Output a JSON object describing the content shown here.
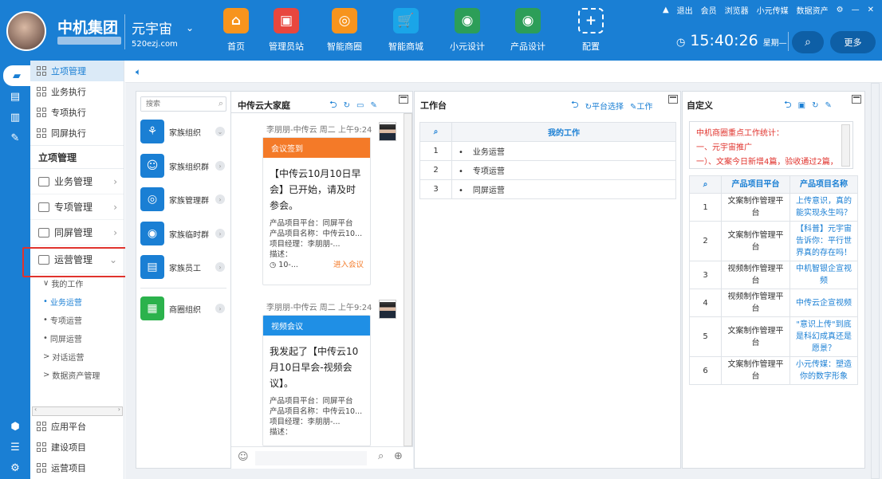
{
  "header": {
    "brand": "中机集团",
    "metaverse": "元宇宙",
    "domain": "520ezj.com",
    "nav": [
      {
        "label": "首页",
        "icon": "home-icon",
        "color": "#f7941d",
        "glyph": "⌂"
      },
      {
        "label": "管理员站",
        "icon": "monitor-icon",
        "color": "#e8473e",
        "glyph": "▣"
      },
      {
        "label": "智能商圈",
        "icon": "ring-icon",
        "color": "#f7941d",
        "glyph": "◎"
      },
      {
        "label": "智能商城",
        "icon": "cart-icon",
        "color": "#1aa5e8",
        "glyph": "🛒"
      },
      {
        "label": "小元设计",
        "icon": "globe-icon",
        "color": "#2c9e58",
        "glyph": "◉"
      },
      {
        "label": "产品设计",
        "icon": "team-icon",
        "color": "#2c9e58",
        "glyph": "◉"
      },
      {
        "label": "配置",
        "icon": "plus-icon",
        "color": "#1a7fd4",
        "glyph": "+"
      }
    ],
    "links": [
      "退出",
      "会员",
      "浏览器",
      "小元传媒",
      "数据资产"
    ],
    "time": "15:40:26",
    "weekday": "星期—",
    "more": "更多"
  },
  "sidebar": {
    "top_items": [
      "立项管理",
      "业务执行",
      "专项执行",
      "同屏执行"
    ],
    "section": "立项管理",
    "groups": [
      "业务管理",
      "专项管理",
      "同屏管理",
      "运营管理"
    ],
    "subs": [
      {
        "label": "我的工作",
        "prefix": "∨"
      },
      {
        "label": "业务运营",
        "prefix": "•"
      },
      {
        "label": "专项运营",
        "prefix": "•"
      },
      {
        "label": "同屏运营",
        "prefix": "•"
      },
      {
        "label": "对话运营",
        "prefix": ">"
      },
      {
        "label": "数据资产管理",
        "prefix": ">"
      }
    ],
    "bottom_items": [
      "应用平台",
      "建设项目",
      "运营项目"
    ]
  },
  "contacts": {
    "search_placeholder": "搜索",
    "categories": [
      {
        "label": "家族组织",
        "color": "#1a7fd4",
        "glyph": "⚘"
      },
      {
        "label": "家族组织群",
        "color": "#1a7fd4",
        "glyph": "☺"
      },
      {
        "label": "家族管理群",
        "color": "#1a7fd4",
        "glyph": "◎"
      },
      {
        "label": "家族临时群",
        "color": "#1a7fd4",
        "glyph": "◉"
      },
      {
        "label": "家族员工",
        "color": "#1a7fd4",
        "glyph": "▤"
      },
      {
        "label": "商圈组织",
        "color": "#2bb24c",
        "glyph": "▦"
      }
    ]
  },
  "chat": {
    "title": "中传云大家庭",
    "messages": [
      {
        "sender": "李朋朋-中传云  周二 上午9:24",
        "header": "会议签到",
        "header_color": "#f47a28",
        "body": "【中传云10月10日早会】已开始，请及时参会。",
        "info": [
          "产品项目平台：同屏平台",
          "产品项目名称：中传云10...",
          "项目经理：李朋朋-...",
          "描述：",
          "◷ 10-..."
        ],
        "action": "进入会议"
      },
      {
        "sender": "李朋朋-中传云  周二 上午9:24",
        "header": "视频会议",
        "header_color": "#1f8fe5",
        "body": "我发起了【中传云10月10日早会-视频会议】。",
        "info": [
          "产品项目平台：同屏平台",
          "产品项目名称：中传云10...",
          "项目经理：李朋朋-...",
          "描述："
        ]
      }
    ]
  },
  "workbench": {
    "title": "工作台",
    "action_platform": "平台选择",
    "action_work": "工作",
    "column": "我的工作",
    "rows": [
      {
        "no": "1",
        "name": "业务运营"
      },
      {
        "no": "2",
        "name": "专项运营"
      },
      {
        "no": "3",
        "name": "同屏运营"
      }
    ]
  },
  "custom": {
    "title": "自定义",
    "notice": [
      "中机商圈重点工作统计：",
      "一、元宇宙推广",
      "一）、文案今日新增4篇，验收通过2篇，"
    ],
    "columns": [
      "产品项目平台",
      "产品项目名称"
    ],
    "rows": [
      {
        "no": "1",
        "platform": "文案制作管理平台",
        "name": "上传意识，真的能实现永生吗？"
      },
      {
        "no": "2",
        "platform": "文案制作管理平台",
        "name": "【科普】元宇宙告诉你：平行世界真的存在吗！"
      },
      {
        "no": "3",
        "platform": "视频制作管理平台",
        "name": "中机智银企宣视频"
      },
      {
        "no": "4",
        "platform": "视频制作管理平台",
        "name": "中传云企宣视频"
      },
      {
        "no": "5",
        "platform": "文案制作管理平台",
        "name": "\"意识上传\"到底是科幻成真还是愿景？"
      },
      {
        "no": "6",
        "platform": "文案制作管理平台",
        "name": "小元传媒：塑造你的数字形象"
      }
    ]
  }
}
